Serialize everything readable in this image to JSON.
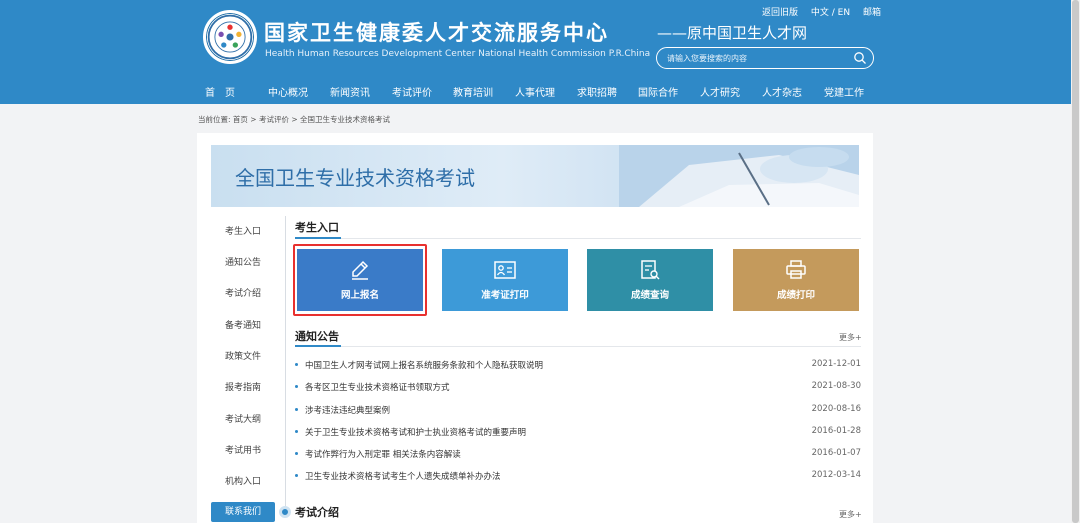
{
  "header": {
    "title": "国家卫生健康委人才交流服务中心",
    "subtitle": "Health Human Resources Development Center National Health Commission P.R.China",
    "former": "——原中国卫生人才网",
    "top_links": [
      "返回旧版",
      "中文 / EN",
      "邮箱"
    ],
    "search_placeholder": "请输入您要搜索的内容"
  },
  "nav": [
    "首　页",
    "中心概况",
    "新闻资讯",
    "考试评价",
    "教育培训",
    "人事代理",
    "求职招聘",
    "国际合作",
    "人才研究",
    "人才杂志",
    "党建工作"
  ],
  "breadcrumb": "当前位置:  首页 > 考试评价 > 全国卫生专业技术资格考试",
  "banner": {
    "title": "全国卫生专业技术资格考试"
  },
  "sidebar": [
    "考生入口",
    "通知公告",
    "考试介绍",
    "备考通知",
    "政策文件",
    "报考指南",
    "考试大纲",
    "考试用书",
    "机构入口",
    "联系我们"
  ],
  "entry": {
    "title": "考生入口",
    "tiles": [
      {
        "label": "网上报名",
        "color": "#3a7bc8",
        "icon": "pencil-icon"
      },
      {
        "label": "准考证打印",
        "color": "#3d9ad8",
        "icon": "id-card-icon"
      },
      {
        "label": "成绩查询",
        "color": "#2f8fa6",
        "icon": "score-search-icon"
      },
      {
        "label": "成绩打印",
        "color": "#c49a5c",
        "icon": "printer-icon"
      }
    ]
  },
  "notices": {
    "title": "通知公告",
    "more": "更多+",
    "items": [
      {
        "title": "中国卫生人才网考试网上报名系统服务条款和个人隐私获取说明",
        "date": "2021-12-01"
      },
      {
        "title": "各考区卫生专业技术资格证书领取方式",
        "date": "2021-08-30"
      },
      {
        "title": "涉考违法违纪典型案例",
        "date": "2020-08-16"
      },
      {
        "title": "关于卫生专业技术资格考试和护士执业资格考试的重要声明",
        "date": "2016-01-28"
      },
      {
        "title": "考试作弊行为入刑定罪 相关法条内容解读",
        "date": "2016-01-07"
      },
      {
        "title": "卫生专业技术资格考试考生个人遗失成绩单补办办法",
        "date": "2012-03-14"
      }
    ]
  },
  "intro": {
    "title": "考试介绍",
    "more": "更多+"
  },
  "colors": {
    "primary": "#2f89c7",
    "highlight": "#e8302f"
  }
}
